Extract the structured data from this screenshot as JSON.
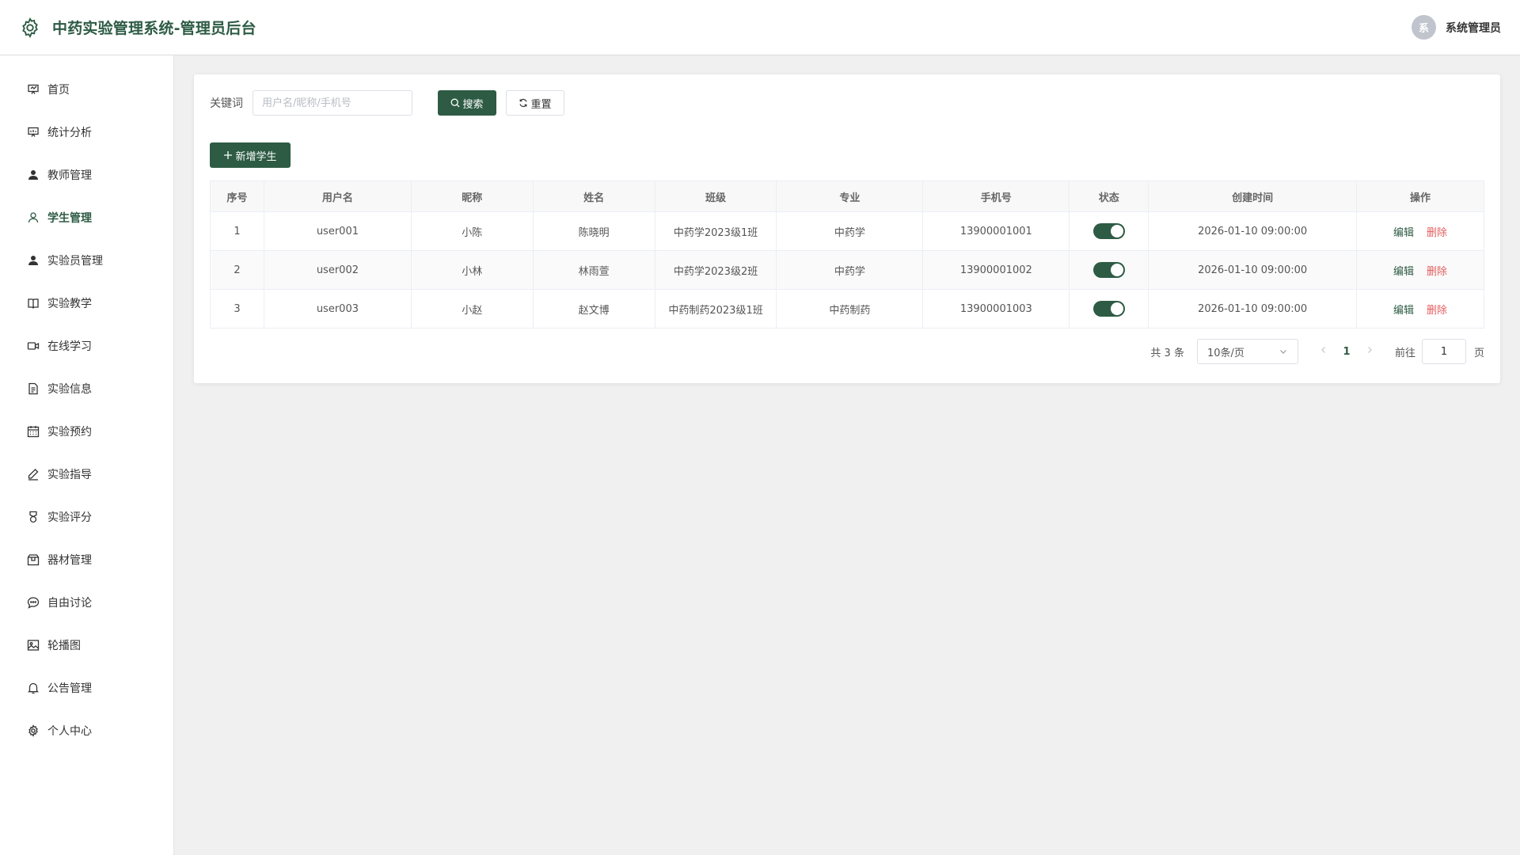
{
  "header": {
    "title": "中药实验管理系统-管理员后台",
    "avatar_text": "系",
    "user_name": "系统管理员"
  },
  "sidebar": {
    "items": [
      {
        "label": "首页",
        "icon": "home-icon"
      },
      {
        "label": "统计分析",
        "icon": "presentation-chart-icon"
      },
      {
        "label": "教师管理",
        "icon": "user-filled-icon"
      },
      {
        "label": "学生管理",
        "icon": "user-outline-icon",
        "active": true
      },
      {
        "label": "实验员管理",
        "icon": "user-filled-icon"
      },
      {
        "label": "实验教学",
        "icon": "book-icon"
      },
      {
        "label": "在线学习",
        "icon": "video-camera-icon"
      },
      {
        "label": "实验信息",
        "icon": "document-icon"
      },
      {
        "label": "实验预约",
        "icon": "calendar-icon"
      },
      {
        "label": "实验指导",
        "icon": "pen-icon"
      },
      {
        "label": "实验评分",
        "icon": "medal-icon"
      },
      {
        "label": "器材管理",
        "icon": "box-icon"
      },
      {
        "label": "自由讨论",
        "icon": "chat-bubble-icon"
      },
      {
        "label": "轮播图",
        "icon": "picture-icon"
      },
      {
        "label": "公告管理",
        "icon": "bell-icon"
      },
      {
        "label": "个人中心",
        "icon": "gear-icon"
      }
    ]
  },
  "search": {
    "label": "关键词",
    "placeholder": "用户名/昵称/手机号",
    "value": "",
    "search_button": "搜索",
    "reset_button": "重置"
  },
  "add_button": "新增学生",
  "table": {
    "columns": [
      "序号",
      "用户名",
      "昵称",
      "姓名",
      "班级",
      "专业",
      "手机号",
      "状态",
      "创建时间",
      "操作"
    ],
    "rows": [
      {
        "index": "1",
        "username": "user001",
        "nickname": "小陈",
        "name": "陈晓明",
        "class": "中药学2023级1班",
        "major": "中药学",
        "phone": "13900001001",
        "status_on": true,
        "created": "2026-01-10 09:00:00",
        "edit": "编辑",
        "delete": "删除"
      },
      {
        "index": "2",
        "username": "user002",
        "nickname": "小林",
        "name": "林雨萱",
        "class": "中药学2023级2班",
        "major": "中药学",
        "phone": "13900001002",
        "status_on": true,
        "created": "2026-01-10 09:00:00",
        "edit": "编辑",
        "delete": "删除"
      },
      {
        "index": "3",
        "username": "user003",
        "nickname": "小赵",
        "name": "赵文博",
        "class": "中药制药2023级1班",
        "major": "中药制药",
        "phone": "13900001003",
        "status_on": true,
        "created": "2026-01-10 09:00:00",
        "edit": "编辑",
        "delete": "删除"
      }
    ]
  },
  "pagination": {
    "total_text": "共 3 条",
    "page_size": "10条/页",
    "current_page": "1",
    "goto_label": "前往",
    "goto_value": "1",
    "goto_unit": "页"
  },
  "colors": {
    "primary": "#2d5b44",
    "danger": "#e35d5d"
  }
}
